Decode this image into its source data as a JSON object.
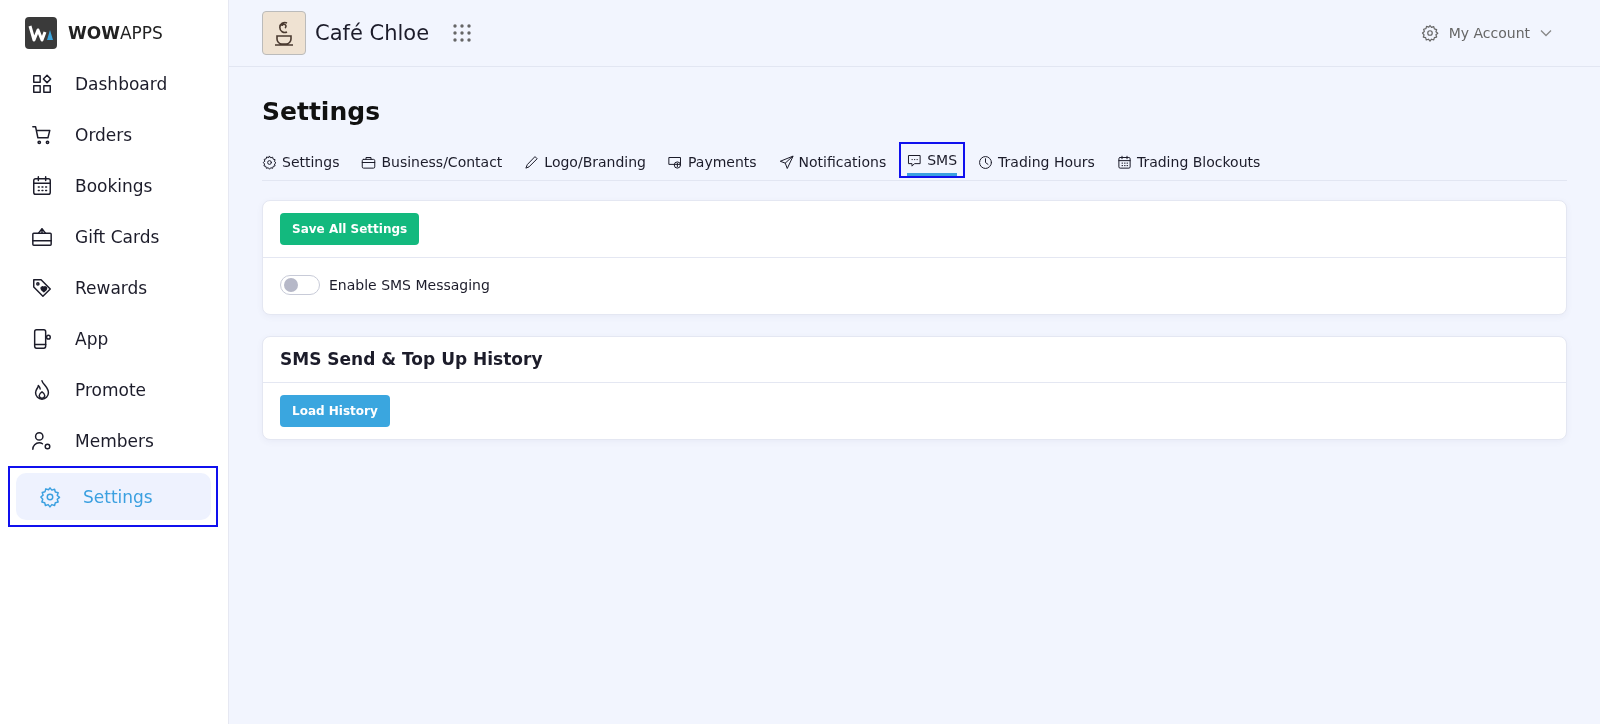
{
  "brand": {
    "name": "**WOW**APPS"
  },
  "sidebar": {
    "items": [
      {
        "label": "Dashboard",
        "selected": false
      },
      {
        "label": "Orders",
        "selected": false
      },
      {
        "label": "Bookings",
        "selected": false
      },
      {
        "label": "Gift Cards",
        "selected": false
      },
      {
        "label": "Rewards",
        "selected": false
      },
      {
        "label": "App",
        "selected": false
      },
      {
        "label": "Promote",
        "selected": false
      },
      {
        "label": "Members",
        "selected": false
      },
      {
        "label": "Settings",
        "selected": true
      }
    ]
  },
  "header": {
    "business": "Café Chloe",
    "account": "My Account"
  },
  "page": {
    "title": "Settings"
  },
  "tabs": [
    {
      "label": "Settings",
      "selected": false
    },
    {
      "label": "Business/Contact",
      "selected": false
    },
    {
      "label": "Logo/Branding",
      "selected": false
    },
    {
      "label": "Payments",
      "selected": false
    },
    {
      "label": "Notifications",
      "selected": false
    },
    {
      "label": "SMS",
      "selected": true
    },
    {
      "label": "Trading Hours",
      "selected": false
    },
    {
      "label": "Trading Blockouts",
      "selected": false
    }
  ],
  "sms_card": {
    "save_button": "Save All Settings",
    "toggle": {
      "label": "Enable SMS Messaging",
      "on": false
    }
  },
  "history_card": {
    "title": "SMS Send & Top Up History",
    "button": "Load History"
  }
}
